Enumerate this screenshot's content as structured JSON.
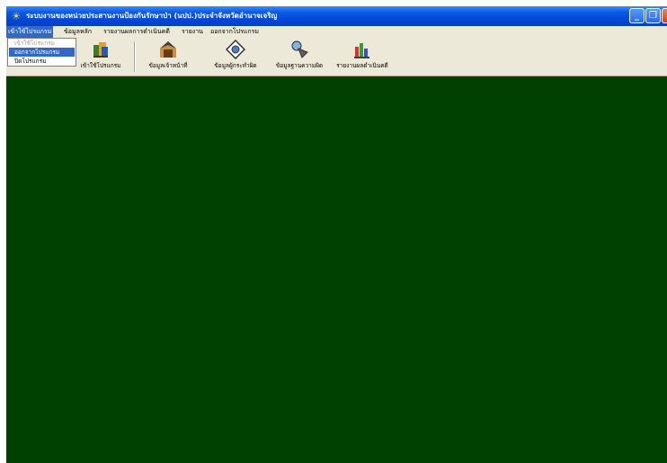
{
  "window": {
    "title": "ระบบงานของหน่วยประสานงานป้องกันรักษาป่า (นปป.)ประจำจังหวัดอำนาจเจริญ",
    "app_icon": "☀",
    "min_glyph": "_",
    "max_glyph": "❐",
    "close_glyph": "✕"
  },
  "menubar": {
    "program": "เข้าใช้โปรแกรม",
    "master": "ข้อมูลหลัก",
    "report_perf": "รายงานผลการดำเนินคดี",
    "report": "รายงาน",
    "exit": "ออกจากโปรแกรม"
  },
  "dropdown": {
    "login": "เข้าใช้โปรแกรม",
    "logout": "ออกจากโปรแกรม",
    "close": "ปิดโปรแกรม"
  },
  "toolbar": {
    "login": "เข้าใช้โปรแกรม",
    "staff": "ข้อมูลเจ้าหน้าที่",
    "offender": "ข้อมูลผู้กระทำผิด",
    "offense": "ข้อมูลฐานความผิด",
    "perf": "รายงานผลดำเนินคดี"
  },
  "colors": {
    "client_bg": "#004000",
    "titlebar": "#0a5be6",
    "selection": "#316ac5"
  }
}
